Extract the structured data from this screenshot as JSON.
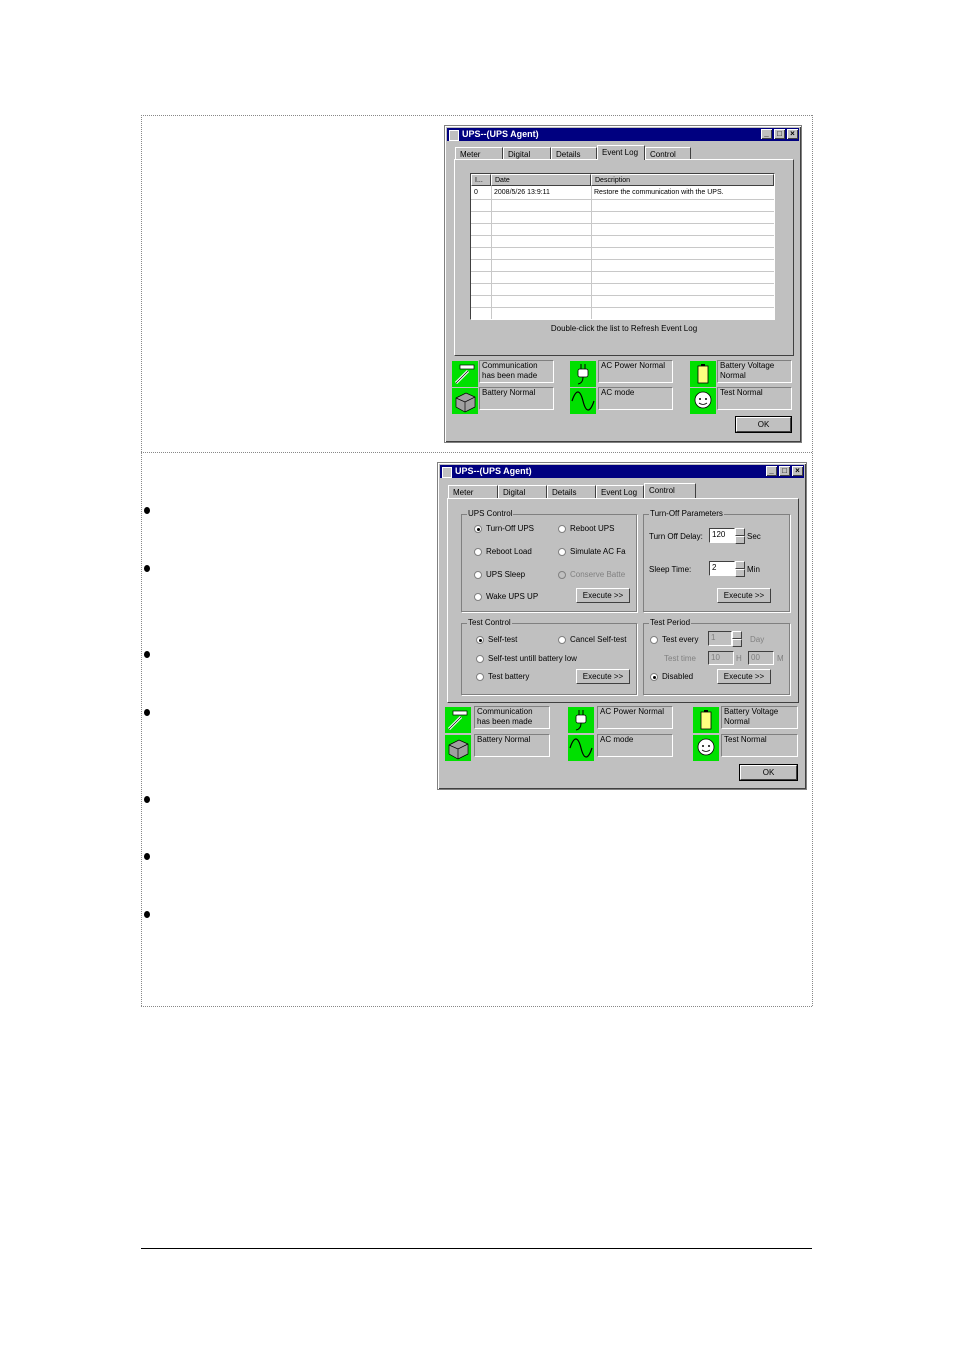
{
  "window1": {
    "title": "UPS--(UPS Agent)",
    "tabs": [
      "Meter",
      "Digital",
      "Details",
      "Event Log",
      "Control"
    ],
    "active_tab": "Event Log",
    "log_headers": [
      "I...",
      "Date",
      "Description"
    ],
    "log_rows": [
      {
        "index": "0",
        "date": "2008/5/26 13:9:11",
        "description": "Restore the communication with the UPS."
      }
    ],
    "hint": "Double-click the list to Refresh Event Log",
    "ok_label": "OK"
  },
  "window2": {
    "title": "UPS--(UPS Agent)",
    "tabs": [
      "Meter",
      "Digital",
      "Details",
      "Event Log",
      "Control"
    ],
    "active_tab": "Control",
    "ups_control": {
      "title": "UPS Control",
      "options": [
        "Turn-Off UPS",
        "Reboot UPS",
        "Reboot Load",
        "Simulate AC Fa",
        "UPS Sleep",
        "Conserve Batte",
        "Wake UPS UP"
      ],
      "execute": "Execute >>"
    },
    "turnoff_params": {
      "title": "Turn-Off Parameters",
      "delay_label": "Turn Off Delay:",
      "delay_value": "120",
      "delay_unit": "Sec",
      "sleep_label": "Sleep Time:",
      "sleep_value": "2",
      "sleep_unit": "Min",
      "execute": "Execute >>"
    },
    "test_control": {
      "title": "Test Control",
      "options": [
        "Self-test",
        "Cancel Self-test",
        "Self-test untill battery low",
        "Test battery"
      ],
      "execute": "Execute >>"
    },
    "test_period": {
      "title": "Test Period",
      "every_label": "Test every",
      "every_value": "1",
      "every_unit": "Day",
      "time_label": "Test time",
      "hour_value": "10",
      "hour_unit": "H",
      "min_value": "00",
      "min_unit": "M",
      "disabled_label": "Disabled",
      "execute": "Execute >>"
    },
    "ok_label": "OK"
  },
  "status": {
    "communication": "Communication has been made",
    "communication_l1": "Communication",
    "communication_l2": "has been made",
    "ac_power": "AC Power Normal",
    "battery_voltage_l1": "Battery Voltage",
    "battery_voltage_l2": "Normal",
    "battery": "Battery Normal",
    "ac_mode": "AC mode",
    "test": "Test Normal"
  },
  "colors": {
    "status_green": "#00e000",
    "titlebar": "#000080",
    "window_face": "#c0c0c0"
  }
}
